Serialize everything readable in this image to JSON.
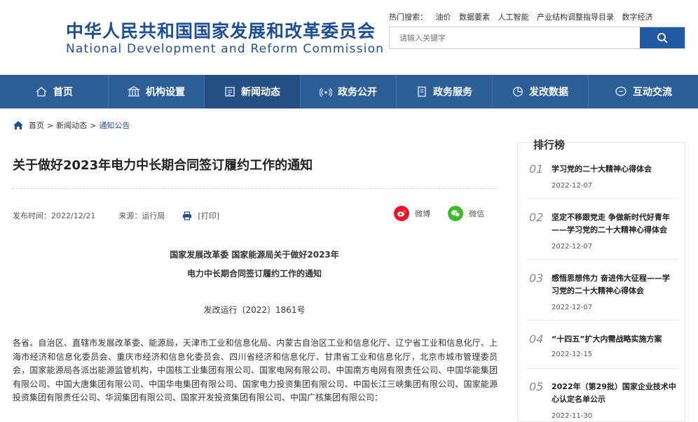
{
  "header": {
    "logo_cn": "中华人民共和国国家发展和改革委员会",
    "logo_en": "National Development and Reform Commission",
    "hot_label": "热门搜索：",
    "hot_items": [
      "油价",
      "数据要素",
      "人工智能",
      "产业结构调整指导目录",
      "数字经济"
    ],
    "search_placeholder": "请输入关键字"
  },
  "nav": {
    "items": [
      "首页",
      "机构设置",
      "新闻动态",
      "政务公开",
      "政务服务",
      "发改数据",
      "互动交流"
    ],
    "active_index": 2
  },
  "breadcrumb": {
    "home": "首页",
    "sep": ">",
    "level2": "新闻动态",
    "current": "通知公告"
  },
  "article": {
    "title": "关于做好2023年电力中长期合同签订履约工作的通知",
    "date_label": "发布时间：2022/12/21",
    "source_label": "来源：运行局",
    "print_label": "[打印]",
    "share_weibo": "微博",
    "share_wechat": "微信",
    "head_line1": "国家发展改革委 国家能源局关于做好2023年",
    "head_line2": "电力中长期合同签订履约工作的通知",
    "doc_no": "发改运行〔2022〕1861号",
    "body": "各省、自治区、直辖市发展改革委、能源局，天津市工业和信息化局、内蒙古自治区工业和信息化厅、辽宁省工业和信息化厅、上海市经济和信息化委员会、重庆市经济和信息化委员会、四川省经济和信息化厅、甘肃省工业和信息化厅，北京市城市管理委员会，国家能源局各派出能源监管机构，中国核工业集团有限公司、国家电网有限公司、中国南方电网有限责任公司、中国华能集团有限公司、中国大唐集团有限公司、中国华电集团有限公司、国家电力投资集团有限公司、中国长江三峡集团有限公司、国家能源投资集团有限责任公司、华润集团有限公司、国家开发投资集团有限公司、中国广核集团有限公司："
  },
  "sidebar": {
    "title": "排行榜",
    "items": [
      {
        "num": "01",
        "text": "学习党的二十大精神心得体会",
        "date": "2022-12-07"
      },
      {
        "num": "02",
        "text": "坚定不移跟党走 争做新时代好青年——学习党的二十大精神心得体会",
        "date": "2022-12-07"
      },
      {
        "num": "03",
        "text": "感悟思想伟力 奋进伟大征程——学习党的二十大精神心得体会",
        "date": "2022-12-07"
      },
      {
        "num": "04",
        "text": "“十四五”扩大内需战略实施方案",
        "date": "2022-12-15"
      },
      {
        "num": "05",
        "text": "2022年（第29批）国家企业技术中心认定名单公示",
        "date": "2022-11-30"
      }
    ]
  },
  "colors": {
    "brand_blue": "#1f4f93",
    "nav_bg": "#2d5f97",
    "nav_active": "#234f82",
    "weibo_red": "#e6162d",
    "wechat_green": "#3dbb2d"
  }
}
